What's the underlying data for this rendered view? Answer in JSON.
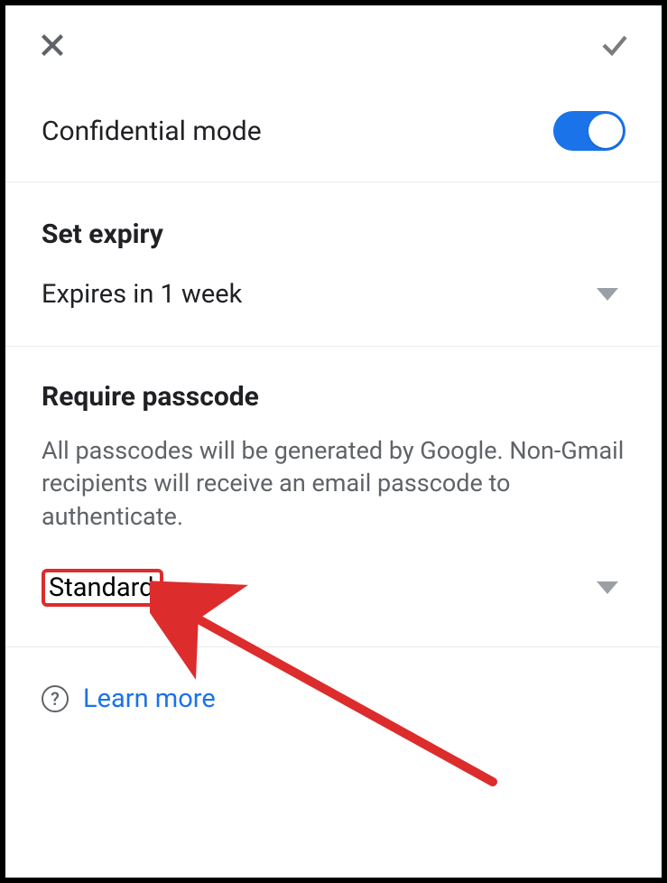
{
  "header": {
    "close_icon": "close-icon",
    "confirm_icon": "check-icon"
  },
  "confidential": {
    "label": "Confidential mode",
    "enabled": true
  },
  "expiry": {
    "title": "Set expiry",
    "value": "Expires in 1 week"
  },
  "passcode": {
    "title": "Require passcode",
    "description": "All passcodes will be generated by Google. Non-Gmail recipients will receive an email passcode to authenticate.",
    "value": "Standard"
  },
  "learn_more": {
    "label": "Learn more"
  },
  "colors": {
    "accent": "#1a73e8",
    "annotation": "#dd2c2c"
  }
}
